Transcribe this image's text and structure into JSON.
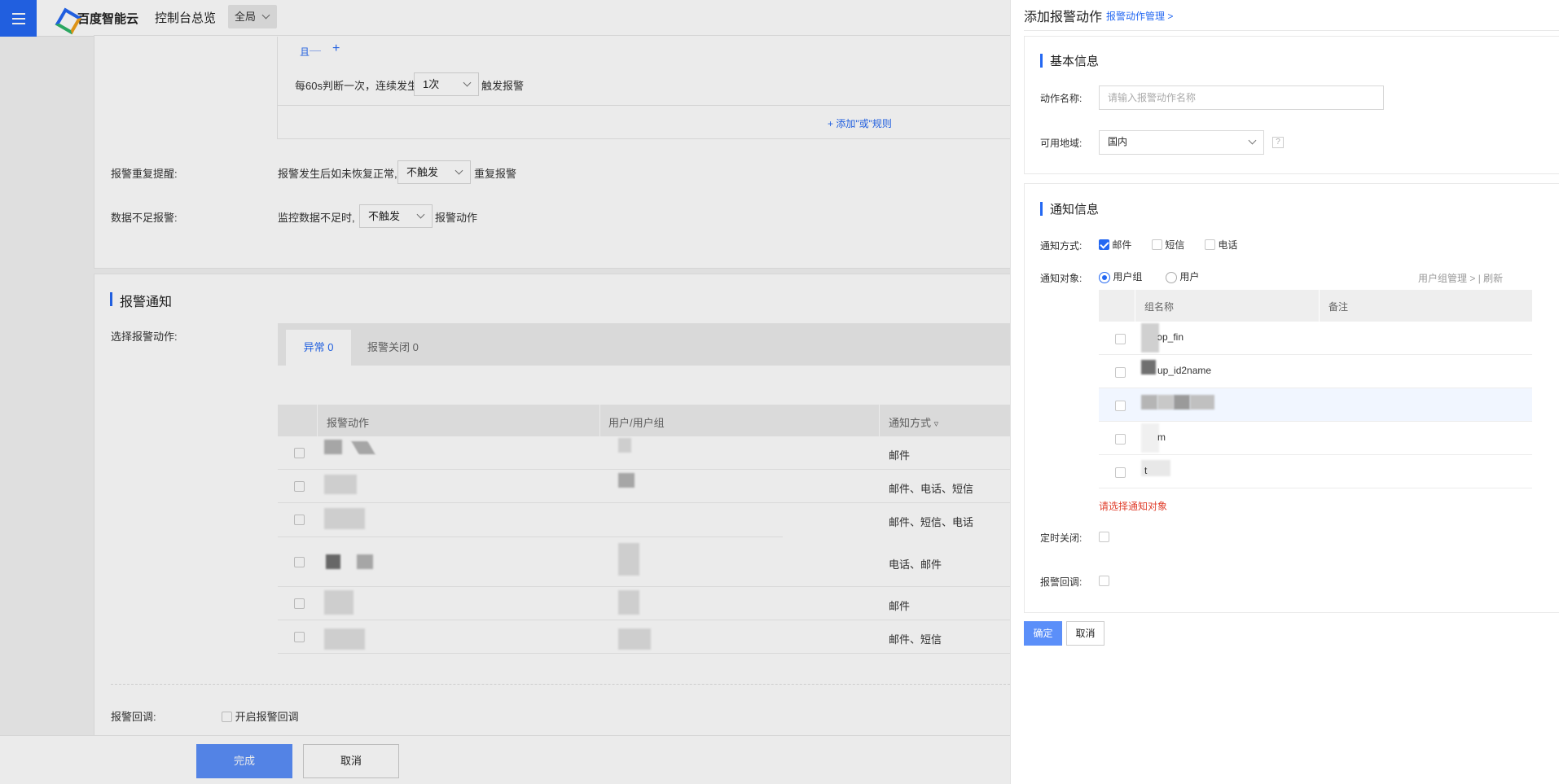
{
  "topbar": {
    "brand": "百度智能云",
    "console": "控制台总览",
    "region": "全局"
  },
  "rule": {
    "and_label": "且",
    "judge_prefix": "每60s判断一次，连续发生",
    "times_value": "1次",
    "judge_suffix": "触发报警",
    "add_or_rule": "添加\"或\"规则"
  },
  "repeat": {
    "label": "报警重复提醒:",
    "prefix": "报警发生后如未恢复正常,",
    "value": "不触发",
    "suffix": "重复报警"
  },
  "insufficient": {
    "label": "数据不足报警:",
    "prefix": "监控数据不足时,",
    "value": "不触发",
    "suffix": "报警动作"
  },
  "notify_section": {
    "title": "报警通知",
    "select_label": "选择报警动作:",
    "tabs": [
      {
        "label": "异常 0"
      },
      {
        "label": "报警关闭 0"
      }
    ],
    "columns": [
      "报警动作",
      "用户/用户组",
      "通知方式"
    ],
    "rows": [
      {
        "method": "邮件"
      },
      {
        "method": "邮件、电话、短信"
      },
      {
        "method": "邮件、短信、电话"
      },
      {
        "method": "电话、邮件"
      },
      {
        "method": "邮件"
      },
      {
        "method": "邮件、短信"
      }
    ]
  },
  "callback": {
    "label": "报警回调:",
    "checkbox_label": "开启报警回调"
  },
  "footer": {
    "done": "完成",
    "cancel": "取消"
  },
  "panel": {
    "title": "添加报警动作",
    "manage_link": "报警动作管理 >",
    "basic": {
      "title": "基本信息",
      "name_label": "动作名称:",
      "name_placeholder": "请输入报警动作名称",
      "region_label": "可用地域:",
      "region_value": "国内",
      "help": "?"
    },
    "notify": {
      "title": "通知信息",
      "method_label": "通知方式:",
      "methods": [
        "邮件",
        "短信",
        "电话"
      ],
      "target_label": "通知对象:",
      "targets": [
        "用户组",
        "用户"
      ],
      "group_manage": "用户组管理 >",
      "refresh": "刷新",
      "separator": "|",
      "columns": [
        "组名称",
        "备注"
      ],
      "groups": [
        {
          "name": "ɔp_fin"
        },
        {
          "name": "up_id2name"
        },
        {
          "name": ""
        },
        {
          "name": "m"
        },
        {
          "name": "t"
        }
      ],
      "error": "请选择通知对象",
      "timer_close_label": "定时关闭:",
      "callback_label": "报警回调:"
    },
    "confirm": "确定",
    "cancel": "取消"
  },
  "colors": {
    "primary": "#2468f2",
    "error": "#e0412f"
  }
}
